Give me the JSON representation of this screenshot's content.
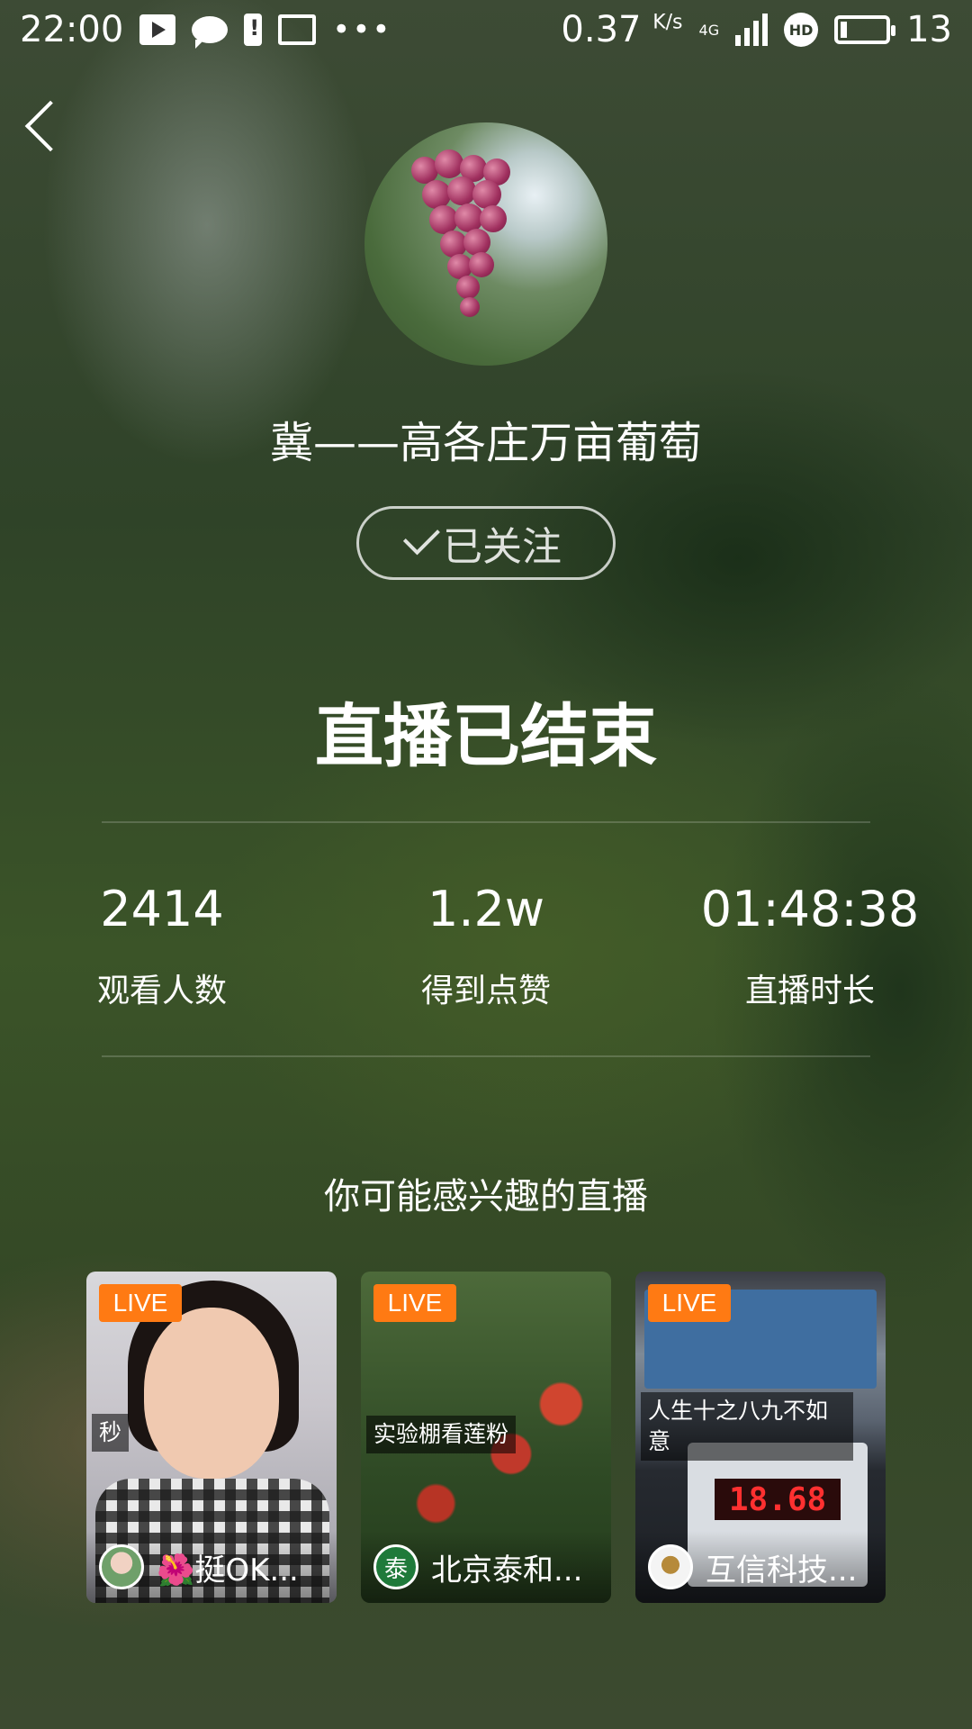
{
  "status_bar": {
    "time": "22:00",
    "speed": "0.37",
    "speed_unit": "K/s",
    "network": "4G",
    "battery": "13"
  },
  "header": {
    "back_icon": "chevron-left-icon"
  },
  "streamer": {
    "name": "冀——高各庄万亩葡萄",
    "follow_label": "已关注"
  },
  "main": {
    "title": "直播已结束"
  },
  "stats": [
    {
      "value": "2414",
      "label": "观看人数"
    },
    {
      "value": "1.2w",
      "label": "得到点赞"
    },
    {
      "value": "01:48:38",
      "label": "直播时长"
    }
  ],
  "suggestions": {
    "title": "你可能感兴趣的直播",
    "cards": [
      {
        "badge": "LIVE",
        "caption": "秒",
        "name": "🌺挺OK..."
      },
      {
        "badge": "LIVE",
        "caption": "实验棚看莲粉",
        "name": "北京泰和..."
      },
      {
        "badge": "LIVE",
        "caption": "人生十之八九不如意",
        "name": "互信科技...",
        "display": "18.68"
      }
    ]
  },
  "colors": {
    "live_badge": "#ff7a13"
  }
}
